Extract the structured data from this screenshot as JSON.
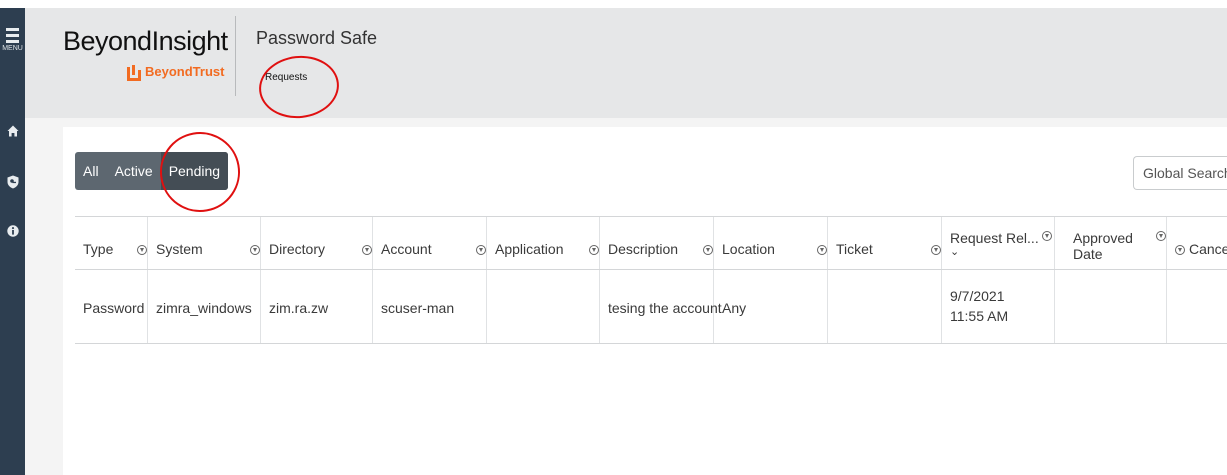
{
  "app": {
    "brand": "BeyondInsight",
    "company": "BeyondTrust",
    "product": "Password Safe",
    "breadcrumb": "Requests",
    "accent_color": "#f26b21"
  },
  "sidebar": {
    "menu_label": "MENU",
    "icons": [
      "home-icon",
      "shield-key-icon",
      "info-icon"
    ]
  },
  "filters": {
    "tabs": [
      {
        "label": "All",
        "selected": false
      },
      {
        "label": "Active",
        "selected": false
      },
      {
        "label": "Pending",
        "selected": true
      }
    ]
  },
  "search": {
    "placeholder": "Global Search"
  },
  "table": {
    "columns": [
      "Type",
      "System",
      "Directory",
      "Account",
      "Application",
      "Description",
      "Location",
      "Ticket",
      "Request Rel...",
      "Approved Date",
      "Cancel"
    ],
    "rows": [
      {
        "type": "Password",
        "system": "zimra_windows",
        "directory": "zim.ra.zw",
        "account": "scuser-man",
        "application": "",
        "description": "tesing the account",
        "location": "Any",
        "ticket": "",
        "request_release": "9/7/2021 11:55 AM",
        "approved_date": "",
        "cancel": ""
      }
    ]
  },
  "annotation_color": "#e01010"
}
